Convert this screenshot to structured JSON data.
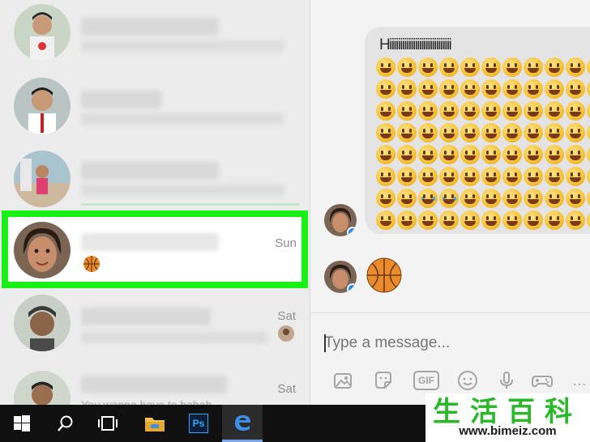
{
  "conversations": [
    {
      "time": ""
    },
    {
      "time": ""
    },
    {
      "time": ""
    },
    {
      "time": "Sun",
      "selected": true,
      "preview_icon": "basketball-icon"
    },
    {
      "time": "Sat"
    },
    {
      "time": "Sat",
      "preview": "You wanna have to hahah"
    }
  ],
  "chat": {
    "message_text": "Hiiiiiiiiiiiiiiiiiiiiiiiiiiiii",
    "emoji_rows": 8,
    "emoji_per_row": 11,
    "sticker": "basketball-icon"
  },
  "composer": {
    "placeholder": "Type a message...",
    "tools": [
      "image-icon",
      "sticker-icon",
      "gif-icon",
      "emoji-icon",
      "microphone-icon",
      "game-controller-icon"
    ],
    "gif_label": "GIF"
  },
  "taskbar": {
    "items": [
      "windows-start-icon",
      "search-icon",
      "task-view-icon",
      "file-explorer-icon",
      "photoshop-icon",
      "edge-icon"
    ],
    "ps_label": "Ps"
  },
  "watermark": {
    "chars": [
      "生",
      "活",
      "百",
      "科"
    ],
    "url": "www.bimeiz.com"
  },
  "colors": {
    "highlight": "#18f018",
    "badge": "#1d8cf0",
    "watermark_green": "#2ab82a"
  }
}
